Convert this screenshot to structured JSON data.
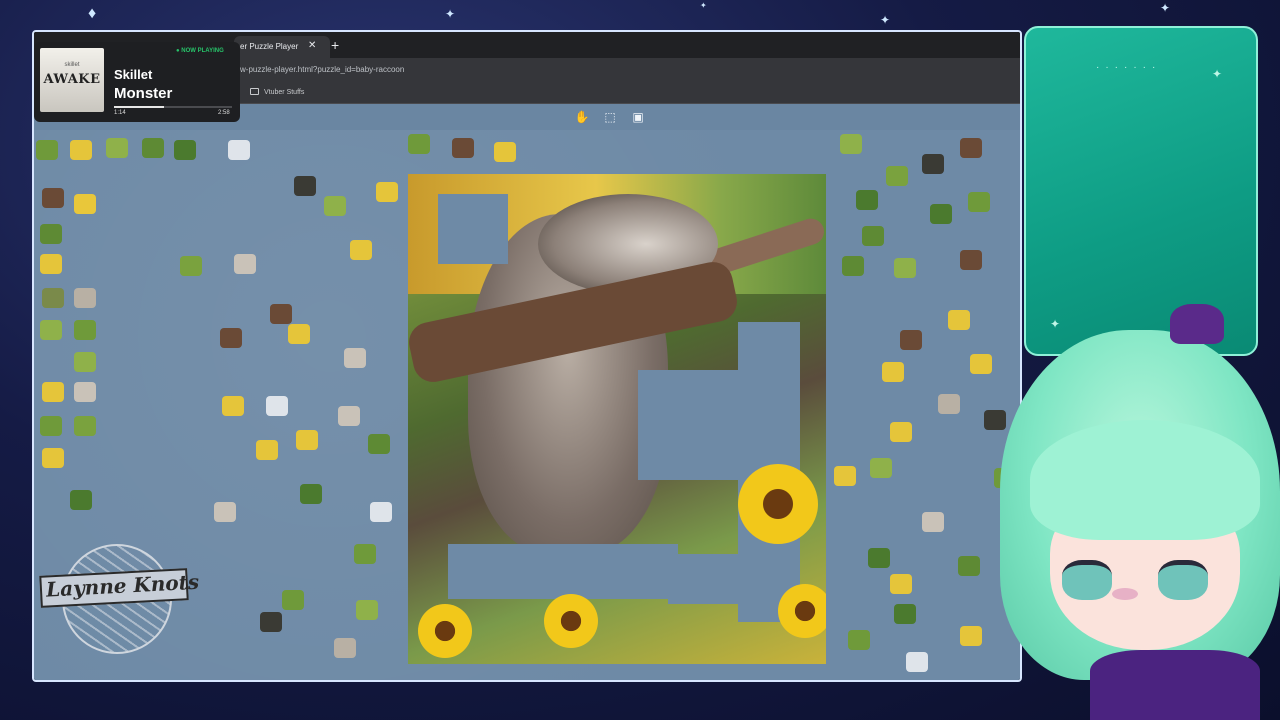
{
  "browser": {
    "tab_title": "er Puzzle Player",
    "url": "w-puzzle-player.html?puzzle_id=baby-raccoon",
    "bookmark": "Vtuber Stuffs"
  },
  "toolbar": {
    "icons": [
      "hand-icon",
      "select-icon",
      "image-icon"
    ]
  },
  "now_playing": {
    "badge": "● NOW PLAYING",
    "album_band": "skillet",
    "album_title": "AWAKE",
    "artist": "Skillet",
    "song": "Monster",
    "time_current": "1:14",
    "time_total": "2:58",
    "progress": 0.42
  },
  "logo": {
    "text": "Laynne Knots"
  },
  "colors": {
    "table": "#6e8aa6",
    "panel": "#12a58b",
    "hair": "#8ee9c9"
  }
}
